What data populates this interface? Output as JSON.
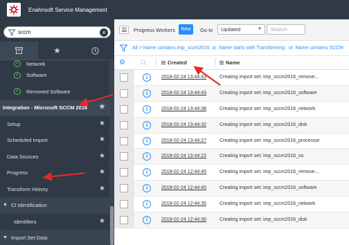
{
  "app": {
    "title": "Enahnsoft Service Management"
  },
  "sidebar": {
    "filter_value": "sccm",
    "tabs": [
      {
        "icon": "archive-icon"
      },
      {
        "icon": "star-icon"
      },
      {
        "icon": "clock-icon"
      }
    ],
    "items": [
      {
        "label": "Network",
        "kind": "child"
      },
      {
        "label": "Software",
        "kind": "child"
      },
      {
        "label": "Removed Software",
        "kind": "child"
      },
      {
        "label": "Integration - Microsoft SCCM 2016",
        "kind": "module"
      },
      {
        "label": "Setup",
        "kind": "sub"
      },
      {
        "label": "Scheduled Import",
        "kind": "sub"
      },
      {
        "label": "Data Sources",
        "kind": "sub"
      },
      {
        "label": "Progress",
        "kind": "sub"
      },
      {
        "label": "Transform History",
        "kind": "sub"
      },
      {
        "label": "CI Identification",
        "kind": "section"
      },
      {
        "label": "Identifiers",
        "kind": "leaf"
      },
      {
        "label": "Import Set Data",
        "kind": "section"
      }
    ]
  },
  "toolbar": {
    "list_title": "Progress Workers",
    "new_label": "New",
    "goto_label": "Go to",
    "goto_value": "Updated",
    "search_placeholder": "Search"
  },
  "breadcrumb": {
    "text": "All > Name contains imp_sccm2016 .or. Name starts with Transforming: .or. Name contains SCCM"
  },
  "columns": {
    "created": "Created",
    "name": "Name"
  },
  "rows": [
    {
      "created": "2018-02-24 13:44:43",
      "name": "Creating import set: imp_sccm2016_remove..."
    },
    {
      "created": "2018-02-24 13:44:43",
      "name": "Creating import set: imp_sccm2016_software"
    },
    {
      "created": "2018-02-24 13:44:38",
      "name": "Creating import set: imp_sccm2016_network"
    },
    {
      "created": "2018-02-24 13:44:32",
      "name": "Creating import set: imp_sccm2016_disk"
    },
    {
      "created": "2018-02-24 13:44:27",
      "name": "Creating import set: imp_sccm2016_processor"
    },
    {
      "created": "2018-02-24 13:44:22",
      "name": "Creating import set: imp_sccm2016_os"
    },
    {
      "created": "2018-02-24 12:44:45",
      "name": "Creating import set: imp_sccm2016_remove..."
    },
    {
      "created": "2018-02-24 12:44:40",
      "name": "Creating import set: imp_sccm2016_software"
    },
    {
      "created": "2018-02-24 12:44:35",
      "name": "Creating import set: imp_sccm2016_network"
    },
    {
      "created": "2018-02-24 12:44:30",
      "name": "Creating import set: imp_sccm2016_disk"
    }
  ],
  "colors": {
    "header": "#303a46",
    "accent": "#278efc",
    "annotation_arrow": "#e02b2b",
    "status_green": "#5fbf5f"
  }
}
